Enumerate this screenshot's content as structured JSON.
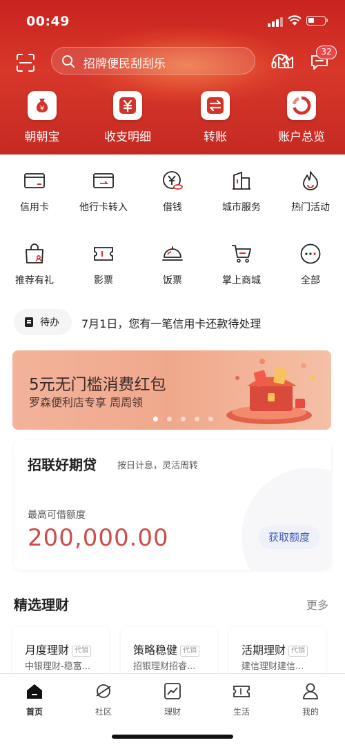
{
  "status_bar": {
    "time": "00:49"
  },
  "header": {
    "search_placeholder": "招牌便民刮刮乐",
    "message_badge": "32",
    "quick_actions": [
      {
        "label": "朝朝宝",
        "icon": "money-bag-icon"
      },
      {
        "label": "收支明细",
        "icon": "yen-icon"
      },
      {
        "label": "转账",
        "icon": "transfer-arrows-icon"
      },
      {
        "label": "账户总览",
        "icon": "ring-chart-icon"
      }
    ]
  },
  "grid": {
    "items": [
      {
        "label": "信用卡",
        "icon": "credit-card-icon"
      },
      {
        "label": "他行卡转入",
        "icon": "card-transfer-icon"
      },
      {
        "label": "借钱",
        "icon": "yen-coin-icon"
      },
      {
        "label": "城市服务",
        "icon": "building-icon"
      },
      {
        "label": "热门活动",
        "icon": "flame-icon"
      },
      {
        "label": "推荐有礼",
        "icon": "gift-bag-icon"
      },
      {
        "label": "影票",
        "icon": "ticket-icon"
      },
      {
        "label": "饭票",
        "icon": "dish-cover-icon"
      },
      {
        "label": "掌上商城",
        "icon": "cart-icon"
      },
      {
        "label": "全部",
        "icon": "more-dots-icon"
      }
    ]
  },
  "todo": {
    "label": "待办",
    "text": "7月1日，您有一笔信用卡还款待处理"
  },
  "banner": {
    "title": "5元无门槛消费红包",
    "subtitle": "罗森便利店专享 周周领",
    "page_count": 5,
    "active_page": 1
  },
  "loan": {
    "title": "招联好期贷",
    "desc": "按日计息，灵活周转",
    "limit_label": "最高可借额度",
    "amount": "200,000.00",
    "button": "获取额度"
  },
  "wealth": {
    "title": "精选理财",
    "more": "更多",
    "tag": "代销",
    "products": [
      {
        "name": "月度理财",
        "desc": "中银理财-稳富..."
      },
      {
        "name": "策略稳健",
        "desc": "招银理财招睿..."
      },
      {
        "name": "活期理财",
        "desc": "建信理财建信..."
      }
    ]
  },
  "tabbar": {
    "tabs": [
      {
        "label": "首页",
        "icon": "home-icon",
        "active": true
      },
      {
        "label": "社区",
        "icon": "planet-icon",
        "active": false
      },
      {
        "label": "理财",
        "icon": "trend-chart-icon",
        "active": false
      },
      {
        "label": "生活",
        "icon": "ticket-icon",
        "active": false
      },
      {
        "label": "我的",
        "icon": "person-icon",
        "active": false
      }
    ]
  },
  "colors": {
    "header_red": "#c9231f",
    "amount_red": "#cf4c4a",
    "button_blue": "#3c5cb0",
    "badge_red": "#e9484a"
  }
}
